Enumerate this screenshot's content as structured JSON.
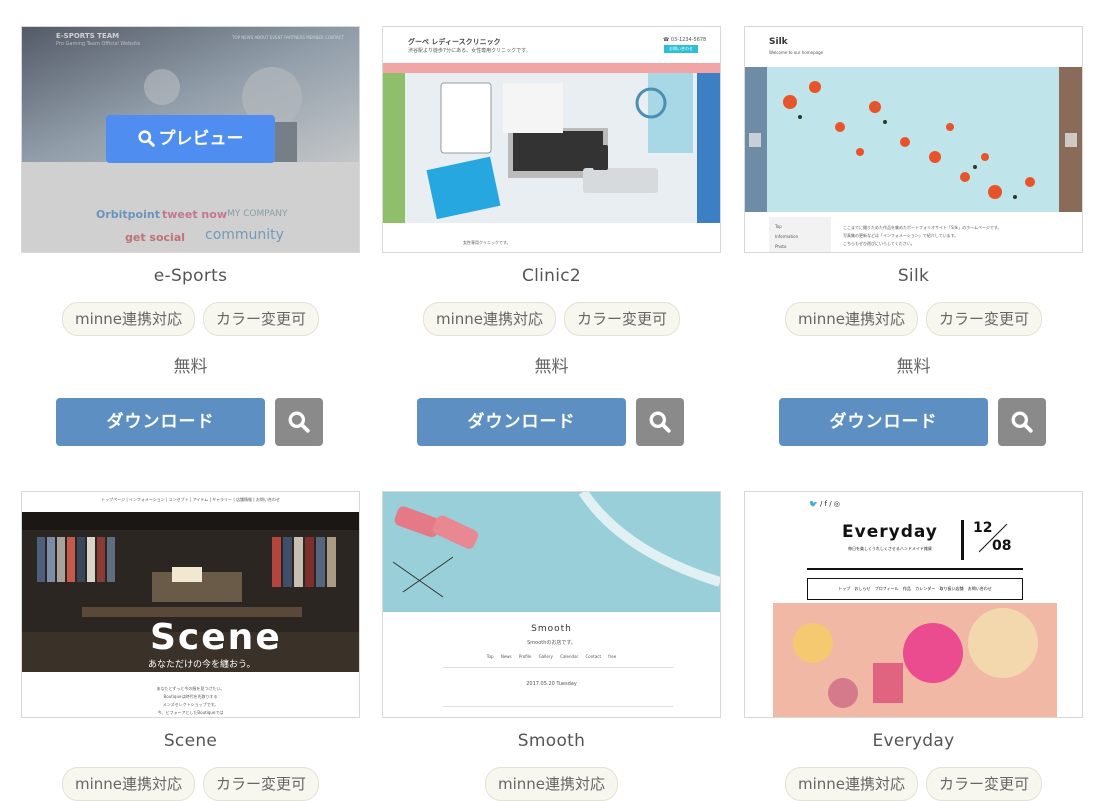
{
  "cards": [
    {
      "name": "e-Sports",
      "tags": [
        "minne連携対応",
        "カラー変更可"
      ],
      "price": "無料",
      "download": "ダウンロード",
      "preview_label": "プレビュー",
      "thumb": {
        "header": "E-SPORTS TEAM",
        "tagline": "Pro Gaming Team Official Website",
        "nav": "TOP NEWS ABOUT EVENT PARTNERS MEMBER CONTACT",
        "sponsors": [
          "Orbitpoint",
          "tweet now",
          "MY COMPANY",
          "get social",
          "community"
        ]
      }
    },
    {
      "name": "Clinic2",
      "tags": [
        "minne連携対応",
        "カラー変更可"
      ],
      "price": "無料",
      "download": "ダウンロード",
      "thumb": {
        "title": "グーペ レディースクリニック",
        "subtitle": "渋谷駅より徒歩7分にある、女性専用クリニックです。",
        "phone": "☎ 03-1234-5678",
        "cta": "お問い合わせ",
        "nav": [
          "トップページ",
          "お知らせ",
          "クリニック紹介",
          "診療案内",
          "アクセス",
          "お問い合わせ"
        ],
        "body": "女性専用クリニックです。"
      }
    },
    {
      "name": "Silk",
      "tags": [
        "minne連携対応",
        "カラー変更可"
      ],
      "price": "無料",
      "download": "ダウンロード",
      "thumb": {
        "title": "Silk",
        "subtitle": "Welcome to our homepage",
        "menu": [
          "Top",
          "Information",
          "Photo"
        ],
        "body1": "ここまでに撮りためた作品を集めたポートフォリオサイト「Silk」のホームページです。",
        "body2": "写真集の更新などは「インフォメーション」で紹介しています。",
        "body3": "こちらもぜひ遊びにいらしてください。"
      }
    },
    {
      "name": "Scene",
      "tags": [
        "minne連携対応",
        "カラー変更可"
      ],
      "thumb": {
        "nav": [
          "トップページ",
          "インフォメーション",
          "コンセプト",
          "アイテム",
          "ギャラリー",
          "店舗情報",
          "お問い合わせ"
        ],
        "hero_title": "Scene",
        "hero_sub": "あなただけの今を纏おう。",
        "body": [
          "あなたとずっと今の服を見つけたい。",
          "Boutiqueは時代を先取りする",
          "メンズセレクトショップです。",
          "今、ビフォーアとしたBoutiqueでは"
        ]
      }
    },
    {
      "name": "Smooth",
      "tags": [
        "minne連携対応"
      ],
      "thumb": {
        "title": "Smooth",
        "subtitle": "Smoothのお店です。",
        "nav": [
          "Top",
          "News",
          "Profile",
          "Gallery",
          "Calendar",
          "Contact",
          "free"
        ],
        "date": "2017.05.20 Tuesday"
      }
    },
    {
      "name": "Everyday",
      "tags": [
        "minne連携対応",
        "カラー変更可"
      ],
      "thumb": {
        "social": "🐦 / f / ◎",
        "title": "Everyday",
        "subtitle": "毎日を楽しくうれしくさせるハンドメイド雑貨",
        "date_month": "12",
        "date_day": "08",
        "nav": [
          "トップ",
          "おしらせ",
          "プロフィール",
          "作品",
          "カレンダー",
          "取り扱い店舗",
          "お問い合わせ"
        ]
      }
    }
  ],
  "colors": {
    "download": "#5d8fc3",
    "zoom": "#8a8a8a",
    "preview": "#4f8ef0"
  }
}
